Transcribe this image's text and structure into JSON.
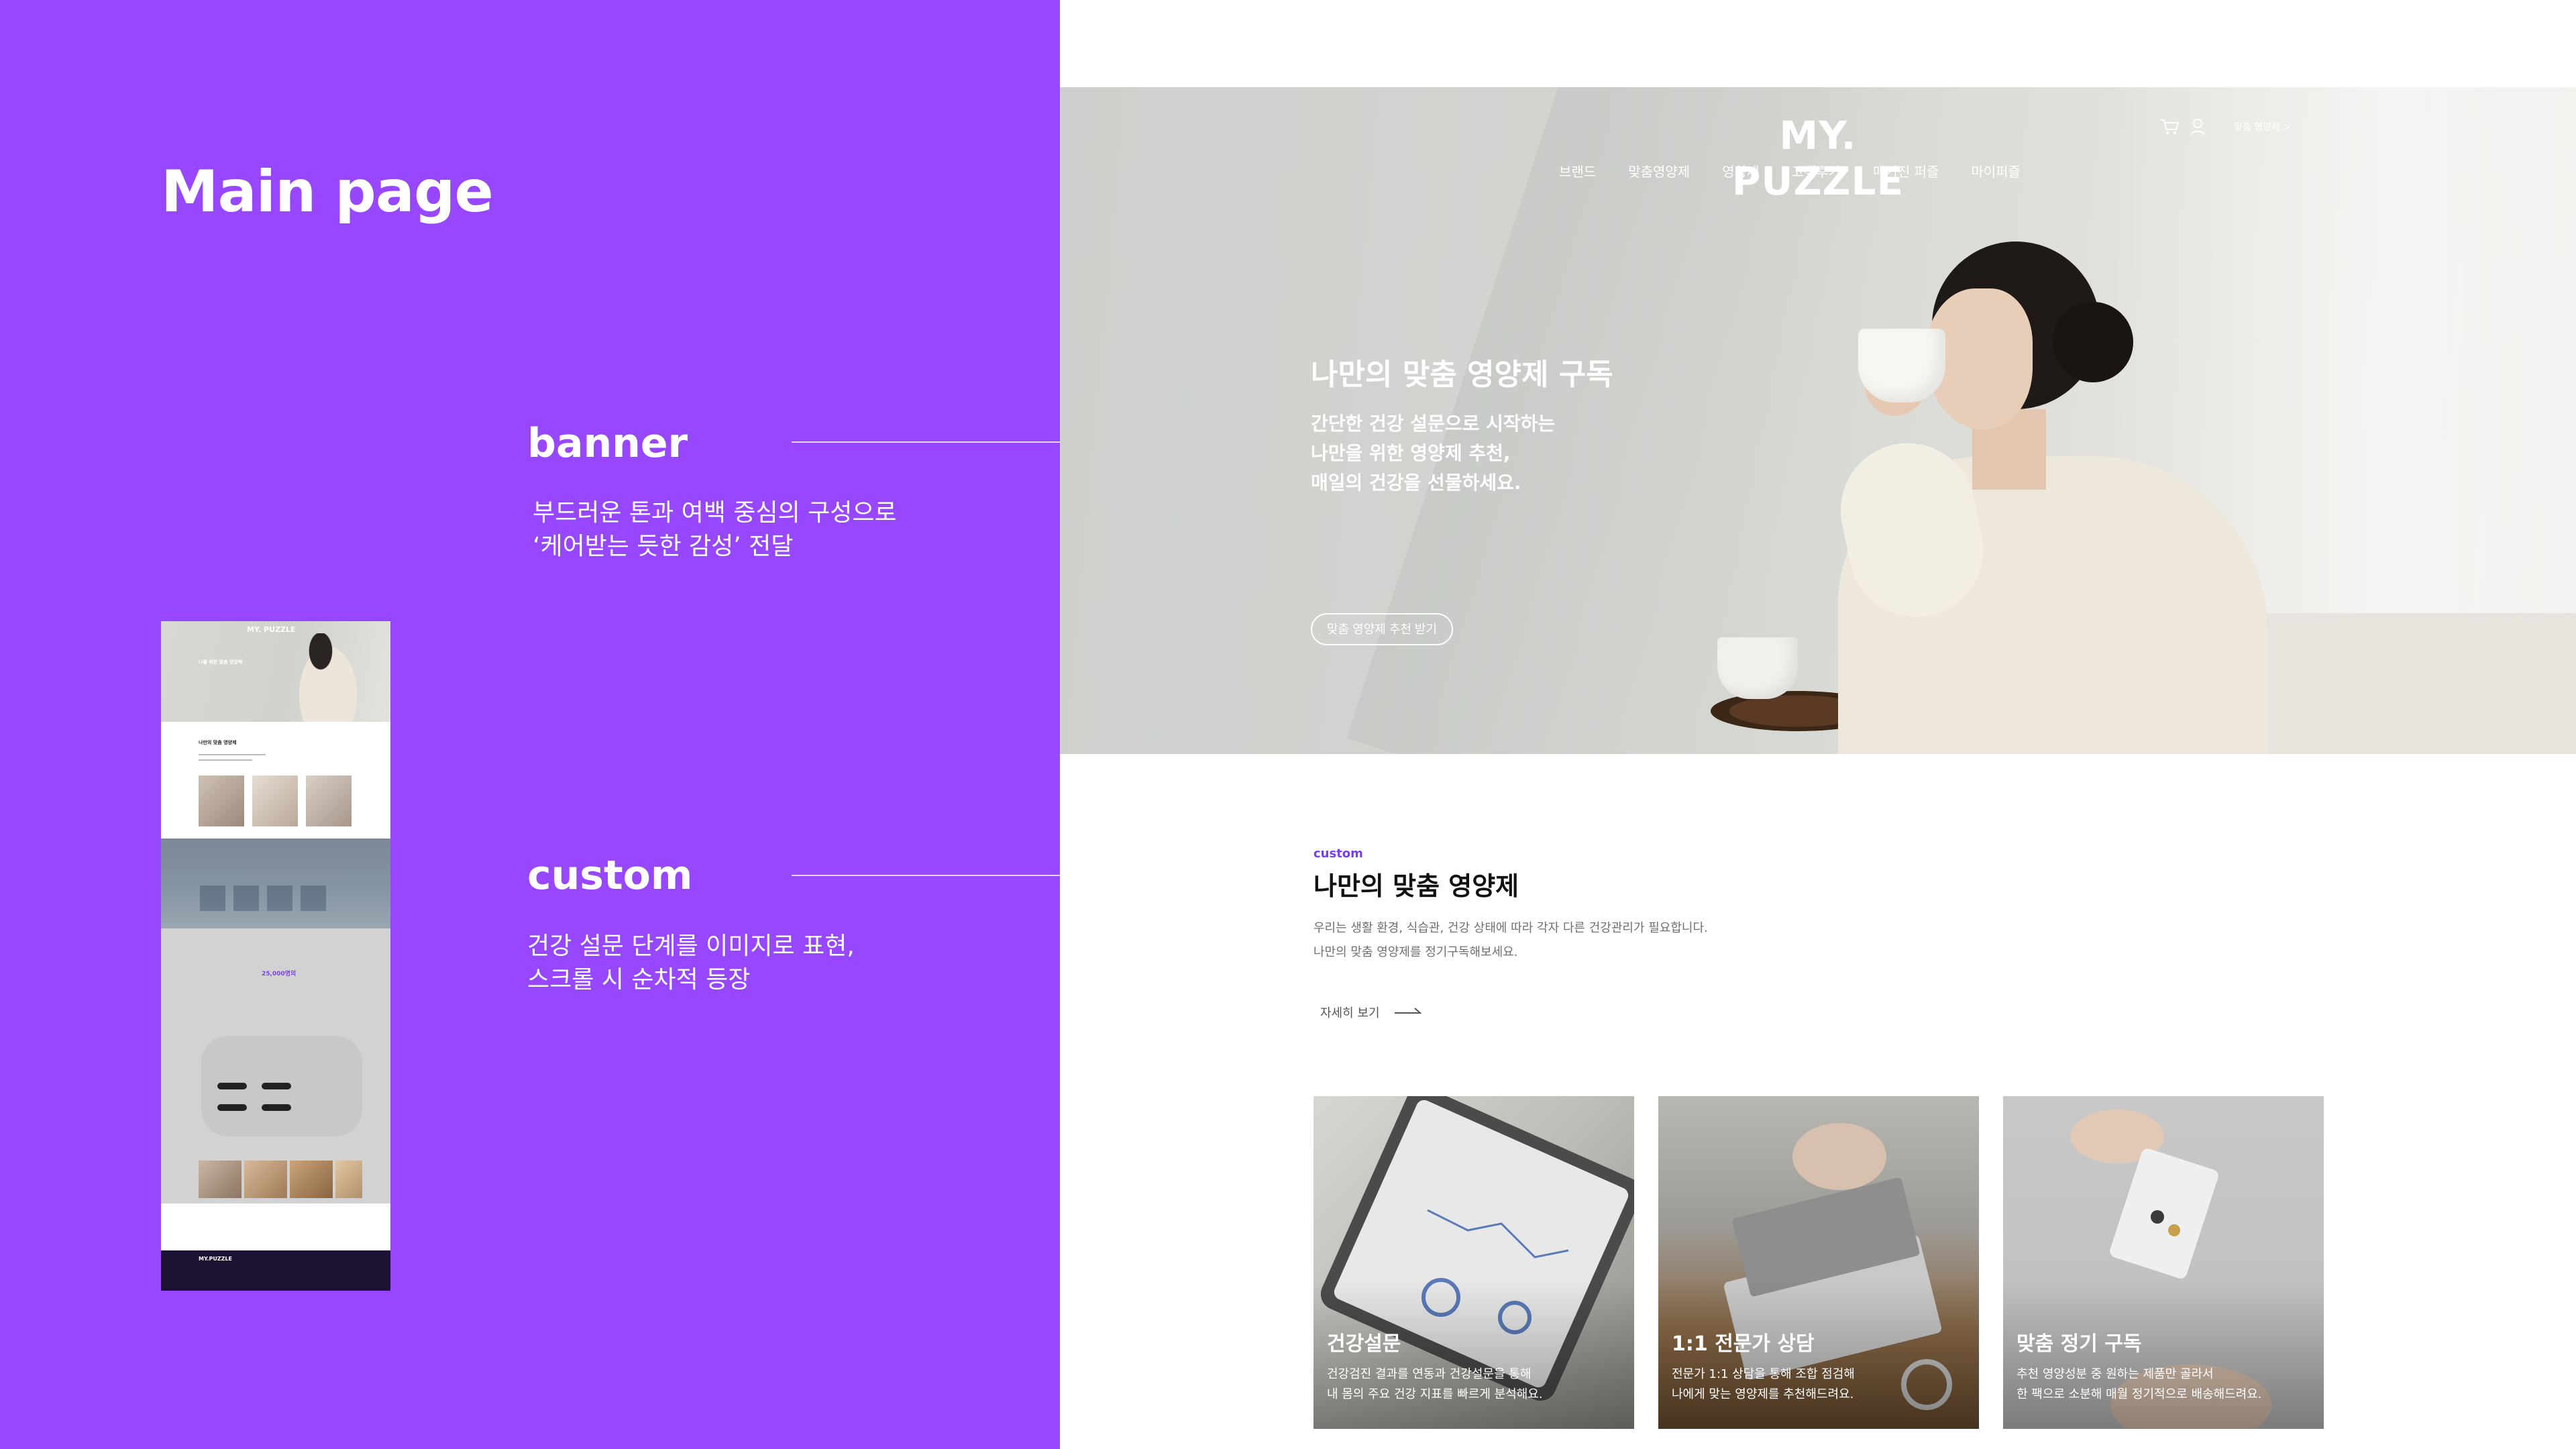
{
  "presentation": {
    "title": "Main page",
    "sections": [
      {
        "label": "banner",
        "description": "부드러운 톤과 여백 중심의 구성으로\n‘케어받는 듯한 감성’ 전달"
      },
      {
        "label": "custom",
        "description": "건강 설문 단계를 이미지로 표현,\n스크롤 시 순차적 등장"
      }
    ],
    "thumbnail": {
      "logo": "MY. PUZZLE",
      "hero_text": "나를 위한 맞춤 영양제",
      "custom_heading": "나만의 맞춤 영양제",
      "stat_text": "25,000명의",
      "footer_logo": "MY.PUZZLE"
    }
  },
  "site": {
    "logo": "MY. PUZZLE",
    "nav": [
      "브랜드",
      "맞춤영양제",
      "영양제",
      "고객후기",
      "매거진 퍼즐",
      "마이퍼즐"
    ],
    "utility_link": "맞춤 영양제 >",
    "icons": [
      "cart-icon",
      "user-icon"
    ],
    "hero": {
      "title": "나만의 맞춤 영양제 구독",
      "subtitle": "간단한 건강 설문으로 시작하는\n나만을 위한 영양제 추천,\n매일의 건강을 선물하세요.",
      "button": "맞춤 영양제 추천 받기"
    },
    "custom": {
      "label": "custom",
      "title": "나만의 맞춤 영양제",
      "description": "우리는 생활 환경, 식습관, 건강 상태에 따라 각자 다른 건강관리가 필요합니다.\n나만의 맞춤 영양제를 정기구독해보세요.",
      "more": "자세히 보기",
      "cards": [
        {
          "title": "건강설문",
          "description": "건강검진 결과를 연동과 건강설문을 통해\n 내 몸의 주요 건강 지표를 빠르게 분석해요."
        },
        {
          "title": "1:1 전문가 상담",
          "description": "전문가 1:1 상담을 통해  조합 점검해\n나에게 맞는 영양제를 추천해드려요."
        },
        {
          "title": "맞춤 정기 구독",
          "description": "추천 영양성분 중 원하는 제품만 골라서\n한 팩으로 소분해 매월 정기적으로 배송해드려요."
        }
      ]
    }
  },
  "colors": {
    "panel": "#9747FF",
    "accent": "#7a3cf0",
    "footer": "#1d1233"
  }
}
